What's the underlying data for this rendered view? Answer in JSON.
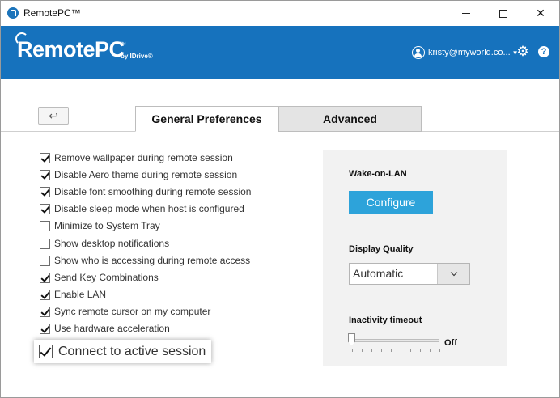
{
  "window": {
    "title": "RemotePC™"
  },
  "header": {
    "logo_text": "RemotePC",
    "logo_tm": "™",
    "logo_by": "by IDrive®",
    "user_email": "kristy@myworld.co...",
    "accent_color": "#1672bd"
  },
  "tabs": [
    {
      "label": "General Preferences",
      "active": true
    },
    {
      "label": "Advanced",
      "active": false
    }
  ],
  "back_label": "↩",
  "options": [
    {
      "label": "Remove wallpaper during remote session",
      "checked": true
    },
    {
      "label": "Disable Aero theme during remote session",
      "checked": true
    },
    {
      "label": "Disable font smoothing during remote session",
      "checked": true
    },
    {
      "label": "Disable sleep mode when host is configured",
      "checked": true
    },
    {
      "label": "Minimize to System Tray",
      "checked": false
    },
    {
      "label": "Show desktop notifications",
      "checked": false
    },
    {
      "label": "Show who is accessing during remote access",
      "checked": false
    },
    {
      "label": "Send Key Combinations",
      "checked": true
    },
    {
      "label": "Enable LAN",
      "checked": true
    },
    {
      "label": "Sync remote cursor on my computer",
      "checked": true
    },
    {
      "label": "Use hardware acceleration",
      "checked": true
    }
  ],
  "highlighted_option": {
    "label": "Connect to active session",
    "checked": true
  },
  "panel": {
    "wake_on_lan_label": "Wake-on-LAN",
    "configure_label": "Configure",
    "display_quality_label": "Display Quality",
    "display_quality_value": "Automatic",
    "inactivity_label": "Inactivity timeout",
    "inactivity_value": "Off",
    "inactivity_level": 0
  },
  "icons": [
    "remotepc-app-icon",
    "minimize-icon",
    "maximize-icon",
    "close-icon",
    "user-icon",
    "gear-icon",
    "help-icon",
    "back-arrow-icon",
    "chevron-down-icon"
  ]
}
